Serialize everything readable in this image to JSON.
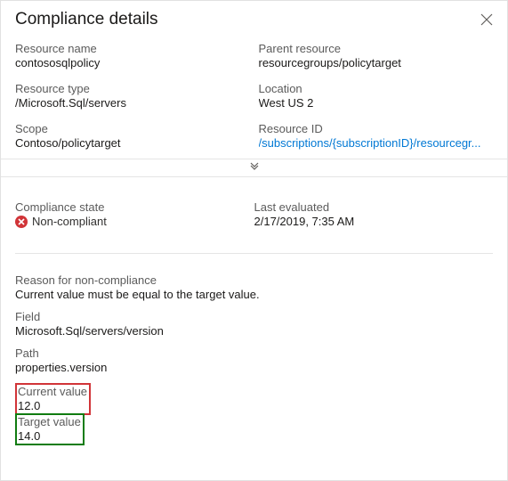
{
  "header": {
    "title": "Compliance details"
  },
  "details": {
    "resource_name": {
      "label": "Resource name",
      "value": "contososqlpolicy"
    },
    "parent_resource": {
      "label": "Parent resource",
      "value": "resourcegroups/policytarget"
    },
    "resource_type": {
      "label": "Resource type",
      "value": "/Microsoft.Sql/servers"
    },
    "location": {
      "label": "Location",
      "value": "West US 2"
    },
    "scope": {
      "label": "Scope",
      "value": "Contoso/policytarget"
    },
    "resource_id": {
      "label": "Resource ID",
      "value": "/subscriptions/{subscriptionID}/resourcegr..."
    }
  },
  "compliance": {
    "state_label": "Compliance state",
    "state_value": "Non-compliant",
    "evaluated_label": "Last evaluated",
    "evaluated_value": "2/17/2019, 7:35 AM"
  },
  "reason": {
    "reason_label": "Reason for non-compliance",
    "reason_value": "Current value must be equal to the target value.",
    "field_label": "Field",
    "field_value": "Microsoft.Sql/servers/version",
    "path_label": "Path",
    "path_value": "properties.version",
    "current_label": "Current value",
    "current_value": "12.0",
    "target_label": "Target value",
    "target_value": "14.0"
  }
}
